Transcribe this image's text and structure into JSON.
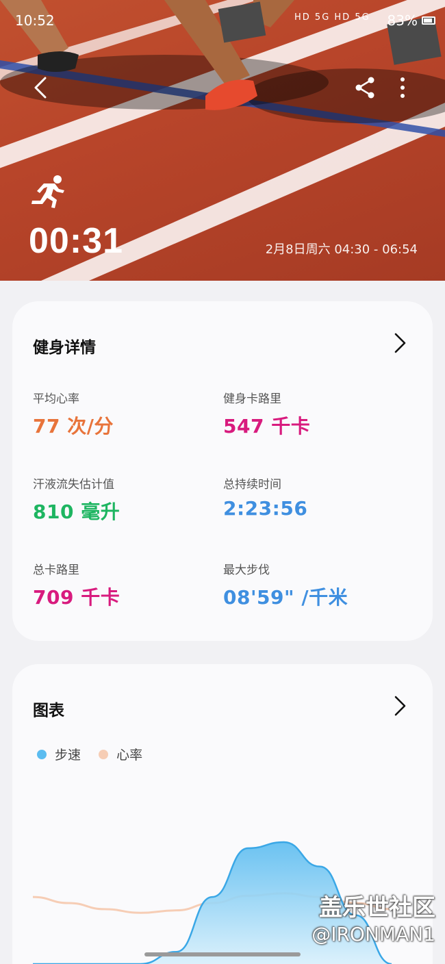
{
  "status_bar": {
    "time": "10:52",
    "network_icons": "HD 5G HD 5G",
    "battery": "83%"
  },
  "header": {
    "back_icon": "back-chevron-icon",
    "share_icon": "share-icon",
    "more_icon": "more-vertical-icon"
  },
  "workout": {
    "activity_icon": "running-icon",
    "duration": "00:31",
    "time_range": "2月8日周六 04:30 - 06:54"
  },
  "details": {
    "title": "健身详情",
    "arrow_icon": "chevron-right-icon",
    "metrics": [
      {
        "label": "平均心率",
        "value": "77 次/分",
        "color": "#e8743b"
      },
      {
        "label": "健身卡路里",
        "value": "547 千卡",
        "color": "#d81b7e"
      },
      {
        "label": "汗液流失估计值",
        "value": "810 毫升",
        "color": "#1eb561"
      },
      {
        "label": "总持续时间",
        "value": "2:23:56",
        "color": "#3f8fe0"
      },
      {
        "label": "总卡路里",
        "value": "709 千卡",
        "color": "#d81b7e"
      },
      {
        "label": "最大步伐",
        "value": "08'59\" /千米",
        "color": "#3f8fe0"
      }
    ]
  },
  "chart_section": {
    "title": "图表",
    "arrow_icon": "chevron-right-icon",
    "legend": [
      {
        "label": "步速",
        "color": "#5bbcf0"
      },
      {
        "label": "心率",
        "color": "#f6cdb5"
      }
    ]
  },
  "chart_data": {
    "type": "area",
    "series": [
      {
        "name": "步速",
        "values": [
          0,
          0,
          0,
          0,
          0.1,
          0.55,
          0.95,
          1.0,
          0.8,
          0.4,
          0.0
        ]
      },
      {
        "name": "心率",
        "values": [
          0.55,
          0.5,
          0.45,
          0.42,
          0.44,
          0.5,
          0.56,
          0.58,
          0.55,
          0.5,
          0.45
        ]
      }
    ]
  },
  "watermark": {
    "line1": "盖乐世社区",
    "line2": "@IRONMAN1"
  }
}
